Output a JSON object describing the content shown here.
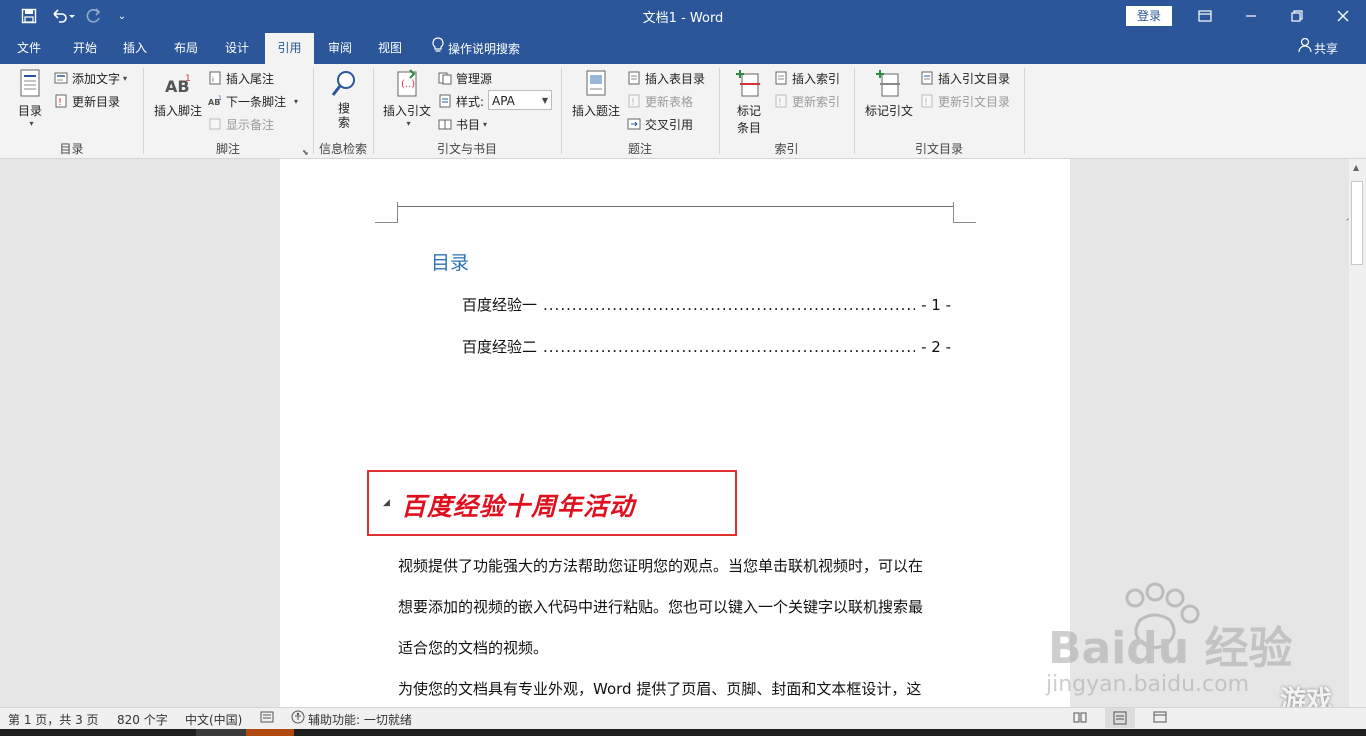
{
  "window": {
    "title": "文档1  -  Word",
    "login_label": "登录"
  },
  "tabs": [
    {
      "label": "文件"
    },
    {
      "label": "开始"
    },
    {
      "label": "插入"
    },
    {
      "label": "布局"
    },
    {
      "label": "设计"
    },
    {
      "label": "引用"
    },
    {
      "label": "审阅"
    },
    {
      "label": "视图"
    }
  ],
  "tell_me": "操作说明搜索",
  "share": "共享",
  "ribbon": {
    "toc": {
      "group_label": "目录",
      "toc_button": "目录",
      "add_text": "添加文字",
      "update_toc": "更新目录"
    },
    "footnotes": {
      "group_label": "脚注",
      "insert_footnote": "插入脚注",
      "insert_endnote": "插入尾注",
      "next_footnote": "下一条脚注",
      "show_notes": "显示备注"
    },
    "research": {
      "group_label": "信息检索",
      "search": "搜索"
    },
    "citations": {
      "group_label": "引文与书目",
      "insert_citation": "插入引文",
      "manage_sources": "管理源",
      "style_label": "样式:",
      "style_value": "APA",
      "bibliography": "书目"
    },
    "captions": {
      "group_label": "题注",
      "insert_caption": "插入题注",
      "insert_table_of_figures": "插入表目录",
      "update_table": "更新表格",
      "cross_reference": "交叉引用"
    },
    "index": {
      "group_label": "索引",
      "mark_entry": "标记条目",
      "insert_index": "插入索引",
      "update_index": "更新索引"
    },
    "authorities": {
      "group_label": "引文目录",
      "mark_citation": "标记引文",
      "insert_toa": "插入引文目录",
      "update_toa": "更新引文目录"
    }
  },
  "document": {
    "toc_title": "目录",
    "toc_entries": [
      {
        "text": "百度经验一",
        "page": "- 1 -"
      },
      {
        "text": "百度经验二",
        "page": "- 2 -"
      }
    ],
    "toc_leader": "...............................................................................................",
    "heading": "百度经验十周年活动",
    "paragraphs": [
      "视频提供了功能强大的方法帮助您证明您的观点。当您单击联机视频时，可以在",
      "想要添加的视频的嵌入代码中进行粘贴。您也可以键入一个关键字以联机搜索最",
      "适合您的文档的视频。",
      "为使您的文档具有专业外观，Word 提供了页眉、页脚、封面和文本框设计，这"
    ]
  },
  "status": {
    "page": "第 1 页，共 3 页",
    "words": "820 个字",
    "language": "中文(中国)",
    "accessibility": "辅助功能: 一切就绪"
  },
  "watermark": {
    "brand": "Baidu 经验",
    "url": "jingyan.baidu.com",
    "game_text": "游戏"
  }
}
